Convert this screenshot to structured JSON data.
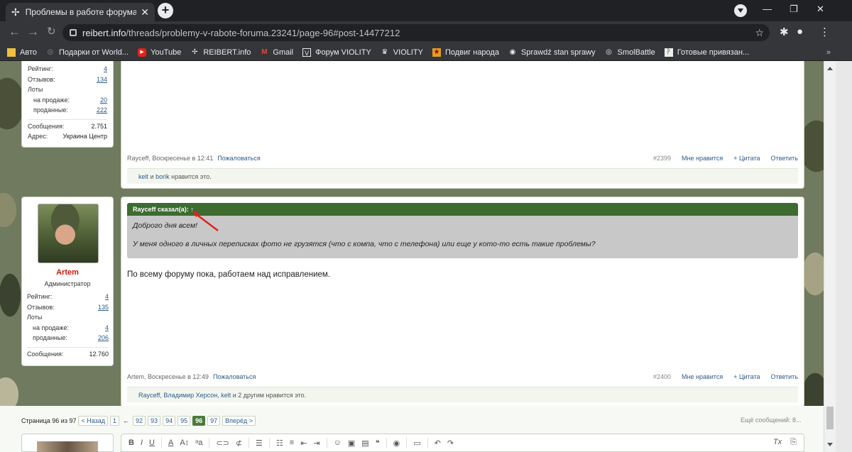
{
  "browser": {
    "tab_title": "Проблемы в работе форума | С",
    "url_host": "reibert.info",
    "url_path": "/threads/problemy-v-rabote-foruma.23241/page-96#post-14477212",
    "bookmarks": [
      "Авто",
      "Подарки от World...",
      "YouTube",
      "REIBERT.info",
      "Gmail",
      "Форум VIOLITY",
      "VIOLITY",
      "Подвиг народа",
      "Sprawdź stan sprawy",
      "SmolBattle",
      "Готовые привязан..."
    ],
    "bookmarks_more": "»"
  },
  "post1": {
    "user": {
      "rating_label": "Рейтинг:",
      "rating": "4",
      "reviews_label": "Отзывов:",
      "reviews": "134",
      "lots_label": "Лоты",
      "selling_label": "на продаже:",
      "selling": "20",
      "sold_label": "проданные:",
      "sold": "222",
      "messages_label": "Сообщения:",
      "messages": "2.751",
      "address_label": "Адрес:",
      "address": "Украина Центр"
    },
    "author_time": "Rayceff, Воскресенье в 12:41",
    "report": "Пожаловаться",
    "number": "#2399",
    "like": "Мне нравится",
    "quote": "+ Цитата",
    "reply": "Ответить",
    "likes": {
      "u1": "kelt",
      "and": "и",
      "u2": "borik",
      "suffix": "нравится это."
    }
  },
  "post2": {
    "user": {
      "name": "Artem",
      "title": "Администратор",
      "rating_label": "Рейтинг:",
      "rating": "4",
      "reviews_label": "Отзывов:",
      "reviews": "135",
      "lots_label": "Лоты",
      "selling_label": "на продаже:",
      "selling": "4",
      "sold_label": "проданные:",
      "sold": "206",
      "messages_label": "Сообщения:",
      "messages": "12.760"
    },
    "quote_head": "Rayceff сказал(а): ↑",
    "quote_line1": "Доброго дня всем!",
    "quote_line2": "У меня одного в личных переписках фото не грузятся (что с компа, что с телефона) или еще у кото-то есть такие проблемы?",
    "message": "По всему форуму пока, работаем над исправлением.",
    "author_time": "Artem, Воскресенье в 12:49",
    "report": "Пожаловаться",
    "number": "#2400",
    "like": "Мне нравится",
    "quote": "+ Цитата",
    "reply": "Ответить",
    "likes": {
      "users": "Rayceff, Владимир Херсон, kelt",
      "rest": "и 2 другим нравится это."
    }
  },
  "pager": {
    "label": "Страница 96 из 97",
    "prev": "< Назад",
    "pages_before": [
      "1"
    ],
    "dash": "←",
    "pages": [
      "92",
      "93",
      "94",
      "95"
    ],
    "current": "96",
    "last": "97",
    "next": "Вперёд >",
    "more": "Ещё сообщений: 8..."
  },
  "editor": {
    "bold": "B",
    "italic": "I",
    "underline": "U"
  }
}
